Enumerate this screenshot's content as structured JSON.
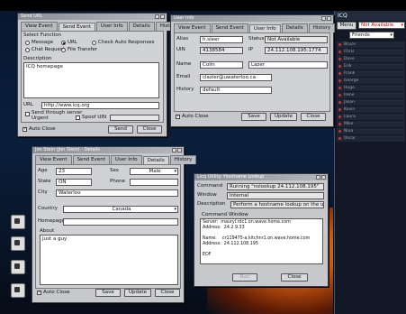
{
  "icq_panel": {
    "title": "ICQ",
    "menu_label": "Menu",
    "status": "Not Available",
    "group": "Friends",
    "contacts": [
      "Bruce",
      "Chris",
      "Dave",
      "Erik",
      "Frank",
      "George",
      "Hugo",
      "Irene",
      "Jason",
      "Kevin",
      "Laura",
      "Mike",
      "Nina",
      "Oscar"
    ]
  },
  "w1": {
    "title": "Send URL",
    "tabs": [
      "View Event",
      "Send Event",
      "User Info",
      "Details",
      "History"
    ],
    "active_tab": 1,
    "select_function_label": "Select Function",
    "opt_message": "Message",
    "opt_url": "URL",
    "opt_check_auto": "Check Auto Responses",
    "opt_chat_request": "Chat Request",
    "opt_file_transfer": "File Transfer",
    "description_label": "Description",
    "description_value": "ICQ homepage",
    "url_label": "URL",
    "url_value": "http://www.icq.org",
    "send_through_server": "Send through server",
    "urgent": "Urgent",
    "spoof_uin": "Spoof UIN",
    "auto_close": "Auto Close",
    "send_button": "Send",
    "close_button": "Close"
  },
  "w2": {
    "title": "User Info",
    "tabs": [
      "View Event",
      "Send Event",
      "User Info",
      "Details",
      "History"
    ],
    "active_tab": 2,
    "alias_label": "Alias",
    "alias_value": "h.sleer",
    "status_label": "Status",
    "status_value": "Not Available",
    "uin_label": "UIN",
    "uin_value": "4138584",
    "ip_label": "IP",
    "ip_value": "24.112.108.195:1774",
    "name_label": "Name",
    "first_name": "Colin",
    "last_name": "Lazer",
    "email_label": "Email",
    "email_value": "clazier@uwaterloo.ca",
    "history_label": "History",
    "history_value": "default",
    "auto_close": "Auto Close",
    "save_button": "Save",
    "update_button": "Update",
    "close_button": "Close"
  },
  "w3": {
    "title": "Jon Stein (Jon Stein) - Details",
    "tabs": [
      "View Event",
      "Send Event",
      "User Info",
      "Details",
      "History"
    ],
    "active_tab": 3,
    "age_label": "Age",
    "age_value": "23",
    "sex_label": "Sex",
    "sex_value": "Male",
    "state_label": "State",
    "state_value": "ON",
    "phone_label": "Phone",
    "phone_value": "",
    "city_label": "City",
    "city_value": "Waterloo",
    "country_label": "Country",
    "country_value": "Canada",
    "homepage_label": "Homepage",
    "homepage_value": "",
    "about_label": "About",
    "about_value": "Just a guy",
    "auto_close": "Auto Close",
    "save_button": "Save",
    "update_button": "Update",
    "close_button": "Close"
  },
  "w4": {
    "title": "Licq Utility: Hostname Lookup",
    "command_label": "Command",
    "command_value": "Running \"nslookup 24.112.108.195\"",
    "window_label": "Window",
    "window_value": "Internal",
    "description_label": "Description",
    "description_value": "Perform a hostname lookup on the user's ip",
    "command_window_label": "Command Window",
    "output": "Server:  mauryl.rdc1.on.wave.home.com\nAddress:  24.2.9.33\n\nName:    cr119475-a.kitchnr1.on.wave.home.com\nAddress:  24.112.108.195\n\nEOF",
    "run_button": "Run",
    "close_button": "Close"
  }
}
